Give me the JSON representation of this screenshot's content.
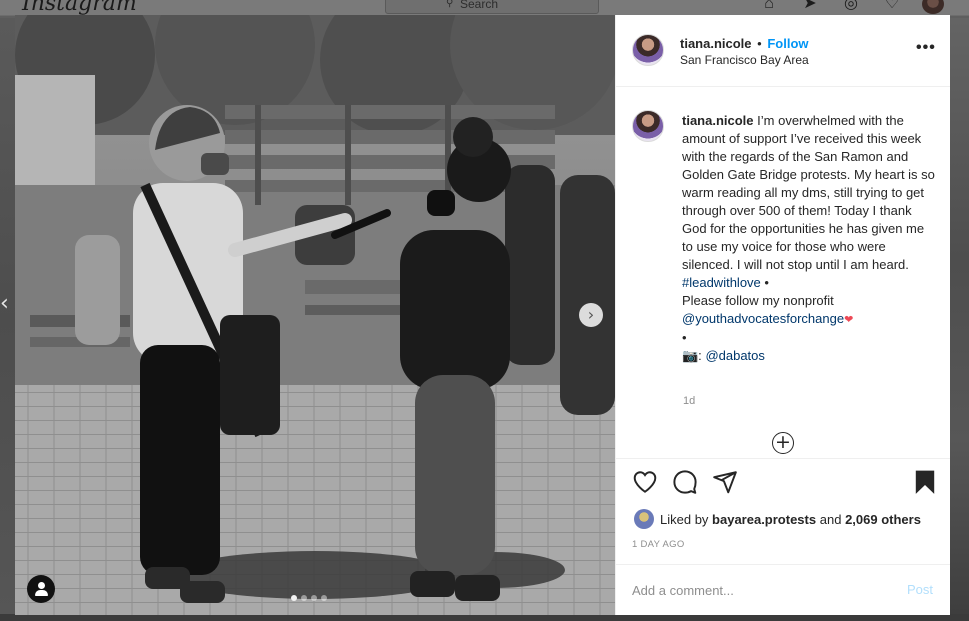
{
  "topbar": {
    "logo": "Instagram",
    "search_placeholder": "Search",
    "nav_icons": [
      "home-icon",
      "direct-icon",
      "explore-icon",
      "heart-icon",
      "profile-avatar"
    ]
  },
  "post": {
    "header": {
      "username": "tiana.nicole",
      "separator": "•",
      "follow_label": "Follow",
      "location": "San Francisco Bay Area",
      "more_label": "•••"
    },
    "caption": {
      "username": "tiana.nicole",
      "text_1": "I’m overwhelmed with the amount of support I’ve received this week with the regards of the San Ramon and Golden Gate Bridge protests. My heart is so warm reading all my dms, still trying to get through over 500 of them! Today I thank God for the opportunities he has given me to use my voice for those who were silenced. I will not stop until I am heard.",
      "hashtag": "#leadwithlove",
      "bullet_1": "•",
      "text_2": "Please follow my nonprofit",
      "mention_1": "@youthadvocatesforchange",
      "heart": "❤",
      "bullet_2": "•",
      "camera": "📷:",
      "mention_2": "@dabatos",
      "age": "1d"
    },
    "load_more_label": "+",
    "likes": {
      "prefix": "Liked by",
      "liker": "bayarea.protests",
      "conjunction": "and",
      "others": "2,069 others"
    },
    "date": "1 DAY AGO",
    "comment": {
      "placeholder": "Add a comment...",
      "post_label": "Post"
    },
    "carousel": {
      "next_label": "›",
      "prev_label": "‹",
      "slide_count": 4,
      "active_slide": 1
    }
  },
  "colors": {
    "accent": "#0095f6",
    "link": "#00376b",
    "muted": "#8e8e8e",
    "post_disabled": "#b2dffc",
    "heart": "#ed4956"
  }
}
